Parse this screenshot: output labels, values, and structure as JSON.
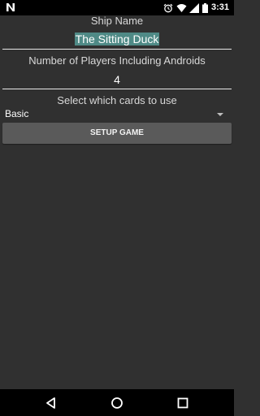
{
  "status_bar": {
    "time": "3:31",
    "icons": [
      "notification-n-icon",
      "alarm-icon",
      "wifi-icon",
      "signal-icon",
      "battery-icon"
    ]
  },
  "form": {
    "ship_name_label": "Ship Name",
    "ship_name_value": "The Sitting Duck",
    "players_label": "Number of Players Including Androids",
    "players_value": "4",
    "cards_label": "Select which cards to use",
    "cards_selected": "Basic",
    "setup_button_label": "SETUP GAME"
  },
  "nav_bar": {
    "icons": [
      "back-icon",
      "home-icon",
      "recents-icon"
    ]
  },
  "colors": {
    "background": "#303030",
    "bars": "#000000",
    "selection": "#4f8a86",
    "button": "#5a5a5a"
  }
}
